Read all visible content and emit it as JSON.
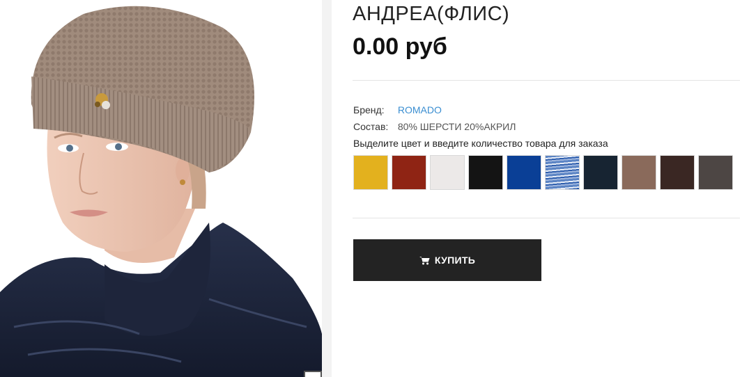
{
  "product": {
    "title": "АНДРЕА(ФЛИС)",
    "price": "0.00 руб"
  },
  "specs": {
    "brand_label": "Бренд:",
    "brand_value": "ROMADO",
    "composition_label": "Состав:",
    "composition_value": "80% ШЕРСТИ 20%АКРИЛ"
  },
  "color_prompt": "Выделите цвет и введите количество товара для заказа",
  "swatches": [
    {
      "color": "#e3b11e"
    },
    {
      "color": "#8f2414"
    },
    {
      "color": "#ece9e8"
    },
    {
      "color": "#141414"
    },
    {
      "color": "#0a3f96"
    },
    {
      "color": "#5b84c4",
      "pattern": "melange"
    },
    {
      "color": "#172432"
    },
    {
      "color": "#8a6a5b"
    },
    {
      "color": "#3a2723"
    },
    {
      "color": "#4d4644"
    }
  ],
  "buy_button": {
    "label": "КУПИТЬ",
    "icon": "cart-icon"
  },
  "image": {
    "icon": "product-photo"
  }
}
